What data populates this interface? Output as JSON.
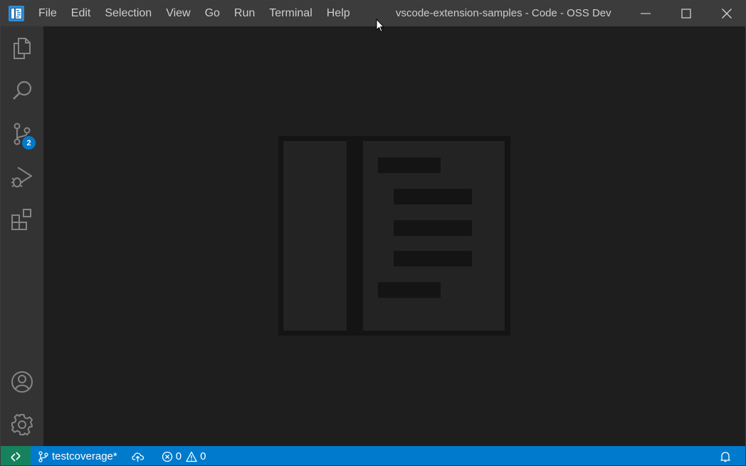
{
  "titlebar": {
    "app_icon": "vscode-oss-icon",
    "menu": [
      "File",
      "Edit",
      "Selection",
      "View",
      "Go",
      "Run",
      "Terminal",
      "Help"
    ],
    "window_title": "vscode-extension-samples - Code - OSS Dev",
    "controls": [
      "minimize-icon",
      "maximize-icon",
      "close-icon"
    ]
  },
  "activitybar": {
    "items": [
      {
        "icon": "files-icon",
        "name": "explorer"
      },
      {
        "icon": "search-icon",
        "name": "search"
      },
      {
        "icon": "source-control-icon",
        "name": "source-control",
        "badge": "2"
      },
      {
        "icon": "run-debug-icon",
        "name": "run-and-debug"
      },
      {
        "icon": "extensions-icon",
        "name": "extensions"
      }
    ],
    "bottom_items": [
      {
        "icon": "account-icon",
        "name": "accounts"
      },
      {
        "icon": "gear-icon",
        "name": "manage"
      }
    ]
  },
  "editor": {
    "watermark_icon": "vscode-letterpress-icon"
  },
  "statusbar": {
    "remote_icon": "remote-icon",
    "branch": "testcoverage*",
    "sync_icon": "cloud-upload-icon",
    "errors": "0",
    "warnings": "0",
    "bell_icon": "bell-icon",
    "colors": {
      "background": "#007acc",
      "remote": "#16825d"
    }
  }
}
